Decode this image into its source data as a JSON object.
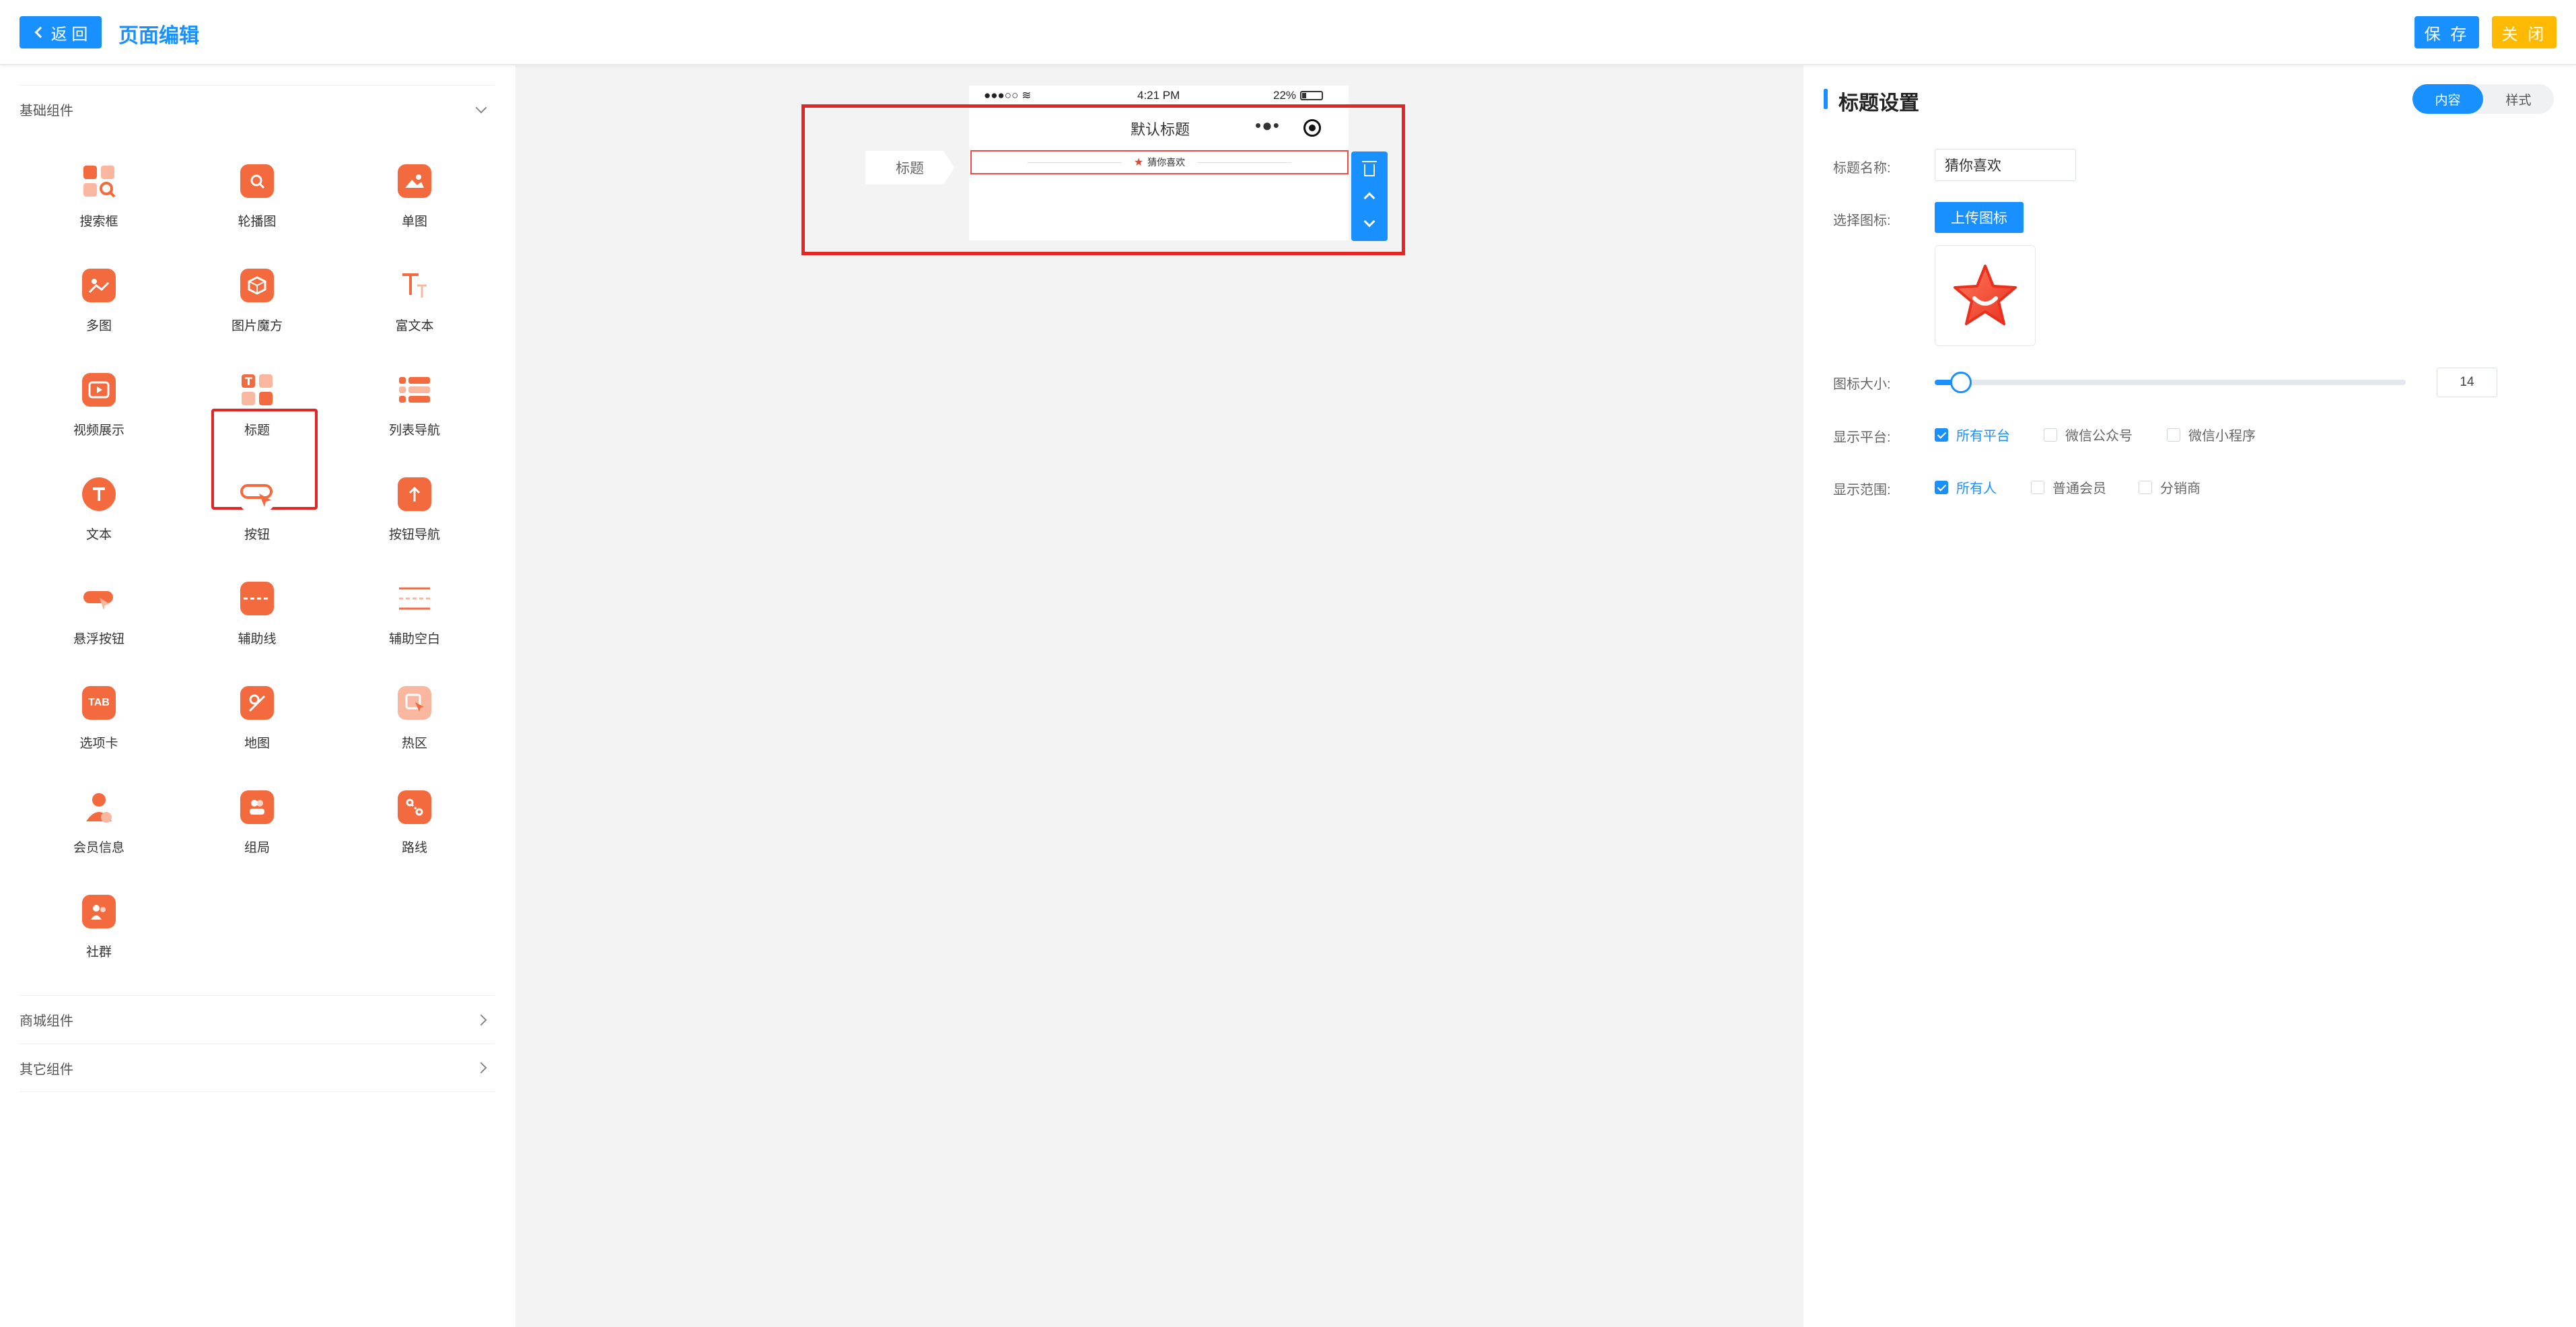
{
  "header": {
    "back_label": "返 回",
    "page_title": "页面编辑",
    "save_label": "保 存",
    "close_label": "关 闭"
  },
  "sidebar": {
    "groups": [
      {
        "label": "基础组件",
        "expanded": true
      },
      {
        "label": "商城组件",
        "expanded": false
      },
      {
        "label": "其它组件",
        "expanded": false
      }
    ],
    "components": [
      {
        "label": "搜索框",
        "icon": "search-box-icon"
      },
      {
        "label": "轮播图",
        "icon": "carousel-icon"
      },
      {
        "label": "单图",
        "icon": "single-image-icon"
      },
      {
        "label": "多图",
        "icon": "multi-image-icon"
      },
      {
        "label": "图片魔方",
        "icon": "image-cube-icon"
      },
      {
        "label": "富文本",
        "icon": "rich-text-icon"
      },
      {
        "label": "视频展示",
        "icon": "video-icon"
      },
      {
        "label": "标题",
        "icon": "title-icon"
      },
      {
        "label": "列表导航",
        "icon": "list-nav-icon"
      },
      {
        "label": "文本",
        "icon": "text-icon"
      },
      {
        "label": "按钮",
        "icon": "button-icon"
      },
      {
        "label": "按钮导航",
        "icon": "button-nav-icon"
      },
      {
        "label": "悬浮按钮",
        "icon": "float-button-icon"
      },
      {
        "label": "辅助线",
        "icon": "guide-line-icon"
      },
      {
        "label": "辅助空白",
        "icon": "blank-space-icon"
      },
      {
        "label": "选项卡",
        "icon": "tab-icon",
        "glyph": "TAB"
      },
      {
        "label": "地图",
        "icon": "map-icon"
      },
      {
        "label": "热区",
        "icon": "hotspot-icon"
      },
      {
        "label": "会员信息",
        "icon": "member-icon"
      },
      {
        "label": "组局",
        "icon": "group-icon"
      },
      {
        "label": "路线",
        "icon": "route-icon"
      },
      {
        "label": "社群",
        "icon": "community-icon"
      }
    ]
  },
  "canvas": {
    "status_time": "4:21 PM",
    "status_battery": "22%",
    "nav_title": "默认标题",
    "title_component_text": "猜你喜欢",
    "side_tag": "标题"
  },
  "settings": {
    "title": "标题设置",
    "tabs": [
      {
        "label": "内容",
        "active": true
      },
      {
        "label": "样式",
        "active": false
      }
    ],
    "name_label": "标题名称:",
    "name_value": "猜你喜欢",
    "icon_label": "选择图标:",
    "upload_label": "上传图标",
    "size_label": "图标大小:",
    "size_value": "14",
    "size_fraction": 0.055,
    "platform_label": "显示平台:",
    "platforms": [
      {
        "label": "所有平台",
        "checked": true
      },
      {
        "label": "微信公众号",
        "checked": false
      },
      {
        "label": "微信小程序",
        "checked": false
      }
    ],
    "scope_label": "显示范围:",
    "scopes": [
      {
        "label": "所有人",
        "checked": true
      },
      {
        "label": "普通会员",
        "checked": false
      },
      {
        "label": "分销商",
        "checked": false
      }
    ]
  },
  "colors": {
    "primary": "#1890ff",
    "accent_orange": "#f26a3d",
    "close_yellow": "#fdba00",
    "selection_red": "#e52424"
  }
}
